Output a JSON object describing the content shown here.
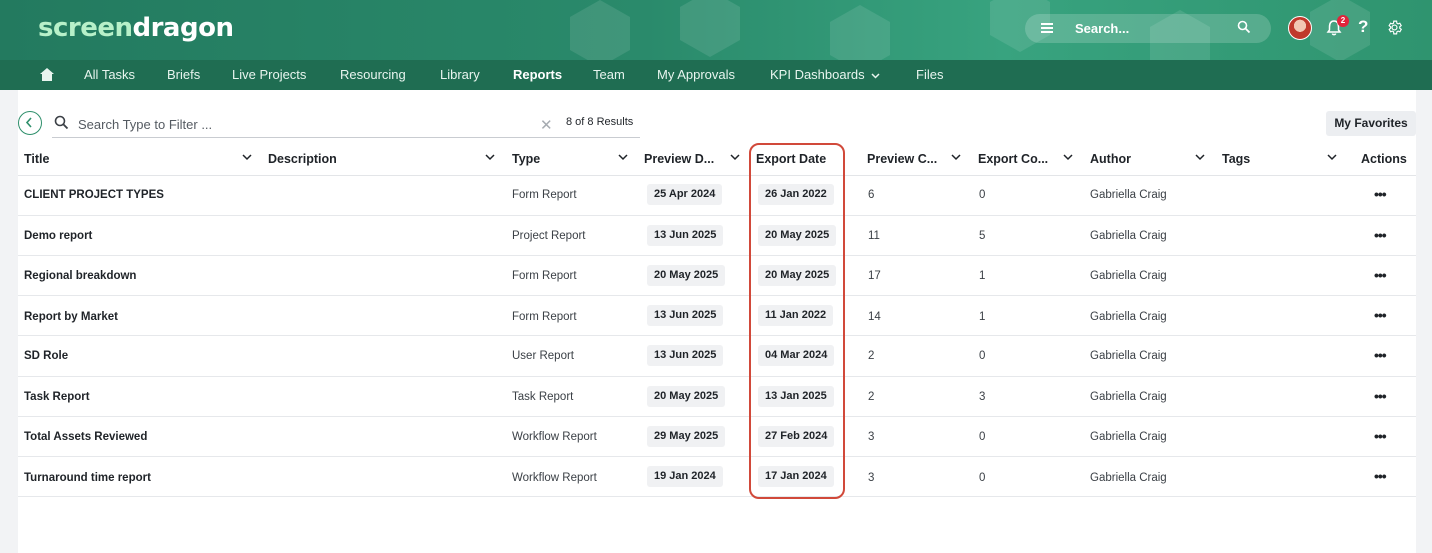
{
  "brand": {
    "part1": "screen",
    "part2": "dragon"
  },
  "header": {
    "search_placeholder": "Search...",
    "notification_count": "2",
    "help_label": "?"
  },
  "nav": {
    "items": [
      "All Tasks",
      "Briefs",
      "Live Projects",
      "Resourcing",
      "Library",
      "Reports",
      "Team",
      "My Approvals",
      "KPI Dashboards",
      "Files"
    ],
    "active": "Reports"
  },
  "toolbar": {
    "filter_label": "Search  Type to Filter ...",
    "clear_glyph": "✕",
    "results": "8 of 8 Results",
    "favorites": "My Favorites"
  },
  "table": {
    "columns": [
      "Title",
      "Description",
      "Type",
      "Preview D...",
      "Export Date",
      "Preview C...",
      "Export Co...",
      "Author",
      "Tags",
      "Actions"
    ],
    "rows": [
      {
        "title": "CLIENT PROJECT TYPES",
        "description": "",
        "type": "Form Report",
        "preview_date": "25 Apr 2024",
        "export_date": "26 Jan 2022",
        "preview_count": "6",
        "export_count": "0",
        "author": "Gabriella Craig",
        "tags": "",
        "actions": "•••"
      },
      {
        "title": "Demo report",
        "description": "",
        "type": "Project Report",
        "preview_date": "13 Jun 2025",
        "export_date": "20 May 2025",
        "preview_count": "11",
        "export_count": "5",
        "author": "Gabriella Craig",
        "tags": "",
        "actions": "•••"
      },
      {
        "title": "Regional breakdown",
        "description": "",
        "type": "Form Report",
        "preview_date": "20 May 2025",
        "export_date": "20 May 2025",
        "preview_count": "17",
        "export_count": "1",
        "author": "Gabriella Craig",
        "tags": "",
        "actions": "•••"
      },
      {
        "title": "Report by Market",
        "description": "",
        "type": "Form Report",
        "preview_date": "13 Jun 2025",
        "export_date": "11 Jan 2022",
        "preview_count": "14",
        "export_count": "1",
        "author": "Gabriella Craig",
        "tags": "",
        "actions": "•••"
      },
      {
        "title": "SD Role",
        "description": "",
        "type": "User Report",
        "preview_date": "13 Jun 2025",
        "export_date": "04 Mar 2024",
        "preview_count": "2",
        "export_count": "0",
        "author": "Gabriella Craig",
        "tags": "",
        "actions": "•••"
      },
      {
        "title": "Task Report",
        "description": "",
        "type": "Task Report",
        "preview_date": "20 May 2025",
        "export_date": "13 Jan 2025",
        "preview_count": "2",
        "export_count": "3",
        "author": "Gabriella Craig",
        "tags": "",
        "actions": "•••"
      },
      {
        "title": "Total Assets Reviewed",
        "description": "",
        "type": "Workflow Report",
        "preview_date": "29 May 2025",
        "export_date": "27 Feb 2024",
        "preview_count": "3",
        "export_count": "0",
        "author": "Gabriella Craig",
        "tags": "",
        "actions": "•••"
      },
      {
        "title": "Turnaround time report",
        "description": "",
        "type": "Workflow Report",
        "preview_date": "19 Jan 2024",
        "export_date": "17 Jan 2024",
        "preview_count": "3",
        "export_count": "0",
        "author": "Gabriella Craig",
        "tags": "",
        "actions": "•••"
      }
    ]
  },
  "colors": {
    "header_green": "#2a8a6b",
    "nav_green": "#1f6d52",
    "highlight": "#d1493a",
    "accent": "#2e8f6b"
  }
}
